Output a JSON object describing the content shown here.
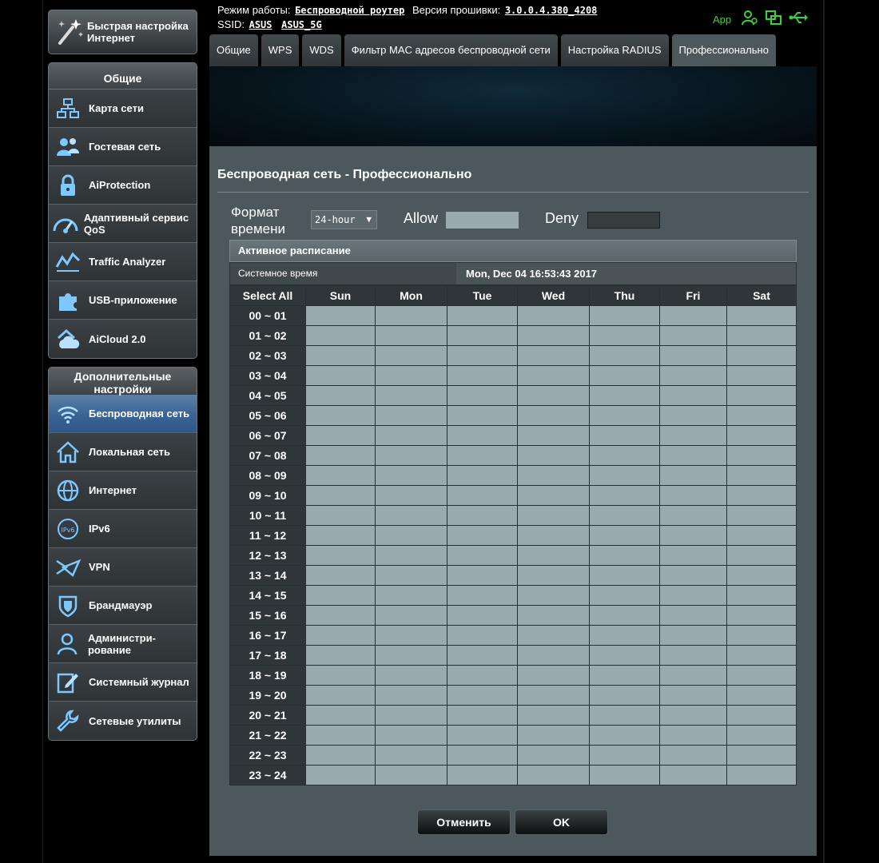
{
  "sidebar": {
    "quick_setup": "Быстрая настройка Интернет",
    "general_title": "Общие",
    "general_items": [
      {
        "label": "Карта сети",
        "icon": "network-map-icon"
      },
      {
        "label": "Гостевая сеть",
        "icon": "guest-network-icon"
      },
      {
        "label": "AiProtection",
        "icon": "lock-icon"
      },
      {
        "label": "Адаптивный сервис QoS",
        "icon": "speedometer-icon"
      },
      {
        "label": "Traffic Analyzer",
        "icon": "traffic-chart-icon"
      },
      {
        "label": "USB-приложение",
        "icon": "puzzle-icon"
      },
      {
        "label": "AiCloud 2.0",
        "icon": "cloud-home-icon"
      }
    ],
    "advanced_title": "Дополнительные настройки",
    "advanced_items": [
      {
        "label": "Беспроводная сеть",
        "icon": "wifi-icon",
        "active": true
      },
      {
        "label": "Локальная сеть",
        "icon": "home-icon"
      },
      {
        "label": "Интернет",
        "icon": "globe-icon"
      },
      {
        "label": "IPv6",
        "icon": "ipv6-globe-icon"
      },
      {
        "label": "VPN",
        "icon": "vpn-icon"
      },
      {
        "label": "Брандмауэр",
        "icon": "shield-icon"
      },
      {
        "label": "Администри-рование",
        "icon": "admin-user-icon"
      },
      {
        "label": "Системный журнал",
        "icon": "log-edit-icon"
      },
      {
        "label": "Сетевые утилиты",
        "icon": "wrench-icon"
      }
    ]
  },
  "topbar": {
    "mode_label": "Режим работы:",
    "mode_value": "Беспроводной роутер",
    "firmware_label": "Версия прошивки:",
    "firmware_value": "3.0.0.4.380_4208",
    "ssid_label": "SSID:",
    "ssid_1": "ASUS",
    "ssid_2": "ASUS_5G",
    "app_label": "App"
  },
  "tabs": [
    {
      "label": "Общие"
    },
    {
      "label": "WPS"
    },
    {
      "label": "WDS"
    },
    {
      "label": "Фильтр MAC адресов беспроводной сети"
    },
    {
      "label": "Настройка RADIUS"
    },
    {
      "label": "Профессионально",
      "active": true
    }
  ],
  "panel": {
    "title": "Беспроводная сеть - Профессионально",
    "time_format_label": "Формат времени",
    "time_format_value": "24-hour",
    "allow_label": "Allow",
    "deny_label": "Deny",
    "schedule_header": "Активное расписание",
    "system_time_label": "Системное время",
    "system_time_value": "Mon, Dec 04 16:53:43 2017"
  },
  "schedule": {
    "select_all": "Select All",
    "days": [
      "Sun",
      "Mon",
      "Tue",
      "Wed",
      "Thu",
      "Fri",
      "Sat"
    ],
    "hours": [
      "00 ~ 01",
      "01 ~ 02",
      "02 ~ 03",
      "03 ~ 04",
      "04 ~ 05",
      "05 ~ 06",
      "06 ~ 07",
      "07 ~ 08",
      "08 ~ 09",
      "09 ~ 10",
      "10 ~ 11",
      "11 ~ 12",
      "12 ~ 13",
      "13 ~ 14",
      "14 ~ 15",
      "15 ~ 16",
      "16 ~ 17",
      "17 ~ 18",
      "18 ~ 19",
      "19 ~ 20",
      "20 ~ 21",
      "21 ~ 22",
      "22 ~ 23",
      "23 ~ 24"
    ]
  },
  "buttons": {
    "cancel": "Отменить",
    "ok": "OK"
  },
  "colors": {
    "allow": "#9baaae",
    "deny": "#373c3e",
    "active_menu": "#3a6394",
    "app_green": "#3cd23c"
  }
}
